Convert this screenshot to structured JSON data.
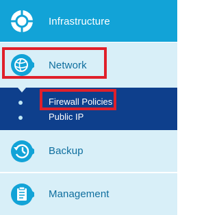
{
  "menu": {
    "items": [
      {
        "label": "Infrastructure",
        "icon": "infrastructure-icon"
      },
      {
        "label": "Network",
        "icon": "globe-network-icon"
      },
      {
        "label": "Backup",
        "icon": "clock-backup-icon"
      },
      {
        "label": "Management",
        "icon": "clipboard-icon"
      }
    ],
    "network_submenu": [
      {
        "label": "Firewall Policies"
      },
      {
        "label": "Public IP"
      }
    ]
  },
  "colors": {
    "primary_blue": "#12a3d7",
    "light_bg": "#d8eff8",
    "submenu_bg": "#0e3f8c",
    "highlight_red": "#e0202b"
  }
}
